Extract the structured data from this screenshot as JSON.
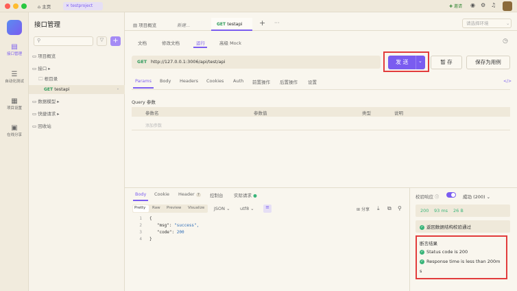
{
  "titlebar": {
    "home_label": "主页",
    "project_tab": "testproject",
    "invite_label": "邀请"
  },
  "rail": {
    "items": [
      "接口管理",
      "自动化测试",
      "项目设置",
      "在线分享"
    ]
  },
  "sidebar": {
    "title": "接口管理",
    "tree": {
      "overview": "项目概览",
      "api": "接口",
      "root": "根目录",
      "api_method": "GET",
      "api_name": "testapi",
      "data_model": "数据模型",
      "quick_request": "快捷请求",
      "recycle": "回收站"
    }
  },
  "tabs": {
    "overview": "项目概览",
    "new": "新建...",
    "active_method": "GET",
    "active_name": "testapi",
    "env_placeholder": "请选择环境"
  },
  "subtabs": {
    "doc": "文档",
    "edit_doc": "修改文档",
    "run": "运行",
    "mock": "高级 Mock"
  },
  "request": {
    "method": "GET",
    "url": "http://127.0.0.1:3006/api/test/api",
    "send": "发 送",
    "save": "暂 存",
    "save_as_case": "保存为用例"
  },
  "param_tabs": [
    "Params",
    "Body",
    "Headers",
    "Cookies",
    "Auth",
    "前置操作",
    "后置操作",
    "设置"
  ],
  "params": {
    "code_label": "</>",
    "query_title": "Query 参数",
    "columns": [
      "参数名",
      "参数值",
      "类型",
      "说明"
    ],
    "add_placeholder": "添加参数"
  },
  "response": {
    "tabs": [
      "Body",
      "Cookie",
      "Header",
      "控制台",
      "实际请求"
    ],
    "header_count": "7",
    "views": [
      "Pretty",
      "Raw",
      "Preview",
      "Visualize"
    ],
    "format": "JSON",
    "encoding": "utf8",
    "share": "分享",
    "lines": [
      {
        "n": "1",
        "t": "{"
      },
      {
        "n": "2",
        "k": "\"msg\"",
        "v": "\"success\","
      },
      {
        "n": "3",
        "k": "\"code\"",
        "v": "200"
      },
      {
        "n": "4",
        "t": "}"
      }
    ]
  },
  "validation": {
    "label": "校验响应",
    "result": "成功 (200)",
    "status": "200",
    "time": "93 ms",
    "size": "26 B",
    "schema_pass": "返回数据结构校验通过",
    "assert_title": "断言结果",
    "assert_1": "Status code is 200",
    "assert_2a": "Response time is less than 200m",
    "assert_2b": "s"
  }
}
